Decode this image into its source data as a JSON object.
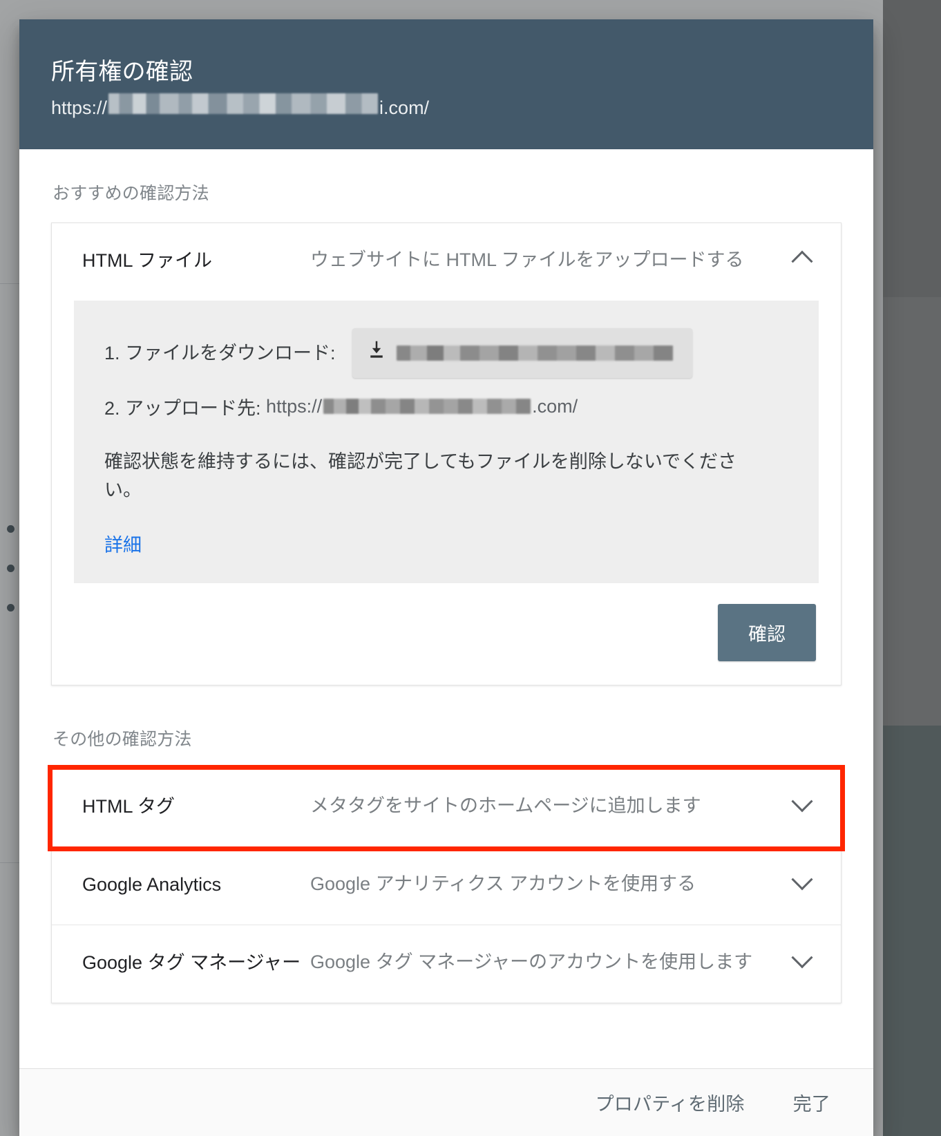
{
  "dialog": {
    "title": "所有権の確認",
    "url_prefix": "https://",
    "url_suffix": "i.com/",
    "recommended_label": "おすすめの確認方法",
    "other_label": "その他の確認方法"
  },
  "html_file_method": {
    "name": "HTML ファイル",
    "description": "ウェブサイトに HTML ファイルをアップロードする",
    "expand_state": "expanded",
    "chevron_icon": "chevron-up-icon",
    "step1_label": "1. ファイルをダウンロード:",
    "download_icon": "download-icon",
    "step2_label": "2. アップロード先:",
    "step2_url_prefix": "https://",
    "step2_url_suffix": ".com/",
    "note": "確認状態を維持するには、確認が完了してもファイルを削除しないでください。",
    "more_link": "詳細",
    "verify_button": "確認"
  },
  "other_methods": [
    {
      "name": "HTML タグ",
      "description": "メタタグをサイトのホームページに追加します",
      "chevron_icon": "chevron-down-icon",
      "highlighted": true
    },
    {
      "name": "Google Analytics",
      "description": "Google アナリティクス アカウントを使用する",
      "chevron_icon": "chevron-down-icon",
      "highlighted": false
    },
    {
      "name": "Google タグ マネージャー",
      "description": "Google タグ マネージャーのアカウントを使用します",
      "chevron_icon": "chevron-down-icon",
      "highlighted": false
    }
  ],
  "footer": {
    "delete_property": "プロパティを削除",
    "done": "完了"
  },
  "colors": {
    "header_bg": "#43596a",
    "verify_button_bg": "#5a7383",
    "highlight_border": "#ff2600",
    "link": "#1a73e8",
    "panel_bg": "#eeeeee"
  }
}
